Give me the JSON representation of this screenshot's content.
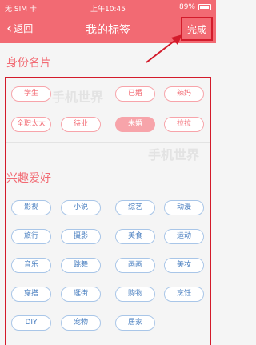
{
  "status_bar": {
    "carrier": "无 SIM 卡",
    "time": "上午10:45",
    "battery": "89%"
  },
  "nav": {
    "back_label": "返回",
    "title": "我的标签",
    "done_label": "完成"
  },
  "sections": {
    "identity": {
      "title": "身份名片",
      "tags": [
        {
          "label": "学生",
          "selected": false
        },
        {
          "label": "已婚",
          "selected": false
        },
        {
          "label": "辣妈",
          "selected": false
        },
        {
          "label": "全职太太",
          "selected": false
        },
        {
          "label": "待业",
          "selected": false
        },
        {
          "label": "未婚",
          "selected": true
        },
        {
          "label": "拉拉",
          "selected": false
        }
      ]
    },
    "interests": {
      "title": "兴趣爱好",
      "tags": [
        "影视",
        "小说",
        "综艺",
        "动漫",
        "旅行",
        "摄影",
        "美食",
        "运动",
        "音乐",
        "跳舞",
        "画画",
        "美妆",
        "穿搭",
        "逛街",
        "购物",
        "烹饪",
        "DIY",
        "宠物",
        "居家"
      ]
    }
  },
  "watermarks": [
    "手机世界",
    "手机世界"
  ],
  "colors": {
    "accent": "#f26a73",
    "annotation_red": "#d31b2b",
    "interest_tag": "#4a7fc0"
  }
}
